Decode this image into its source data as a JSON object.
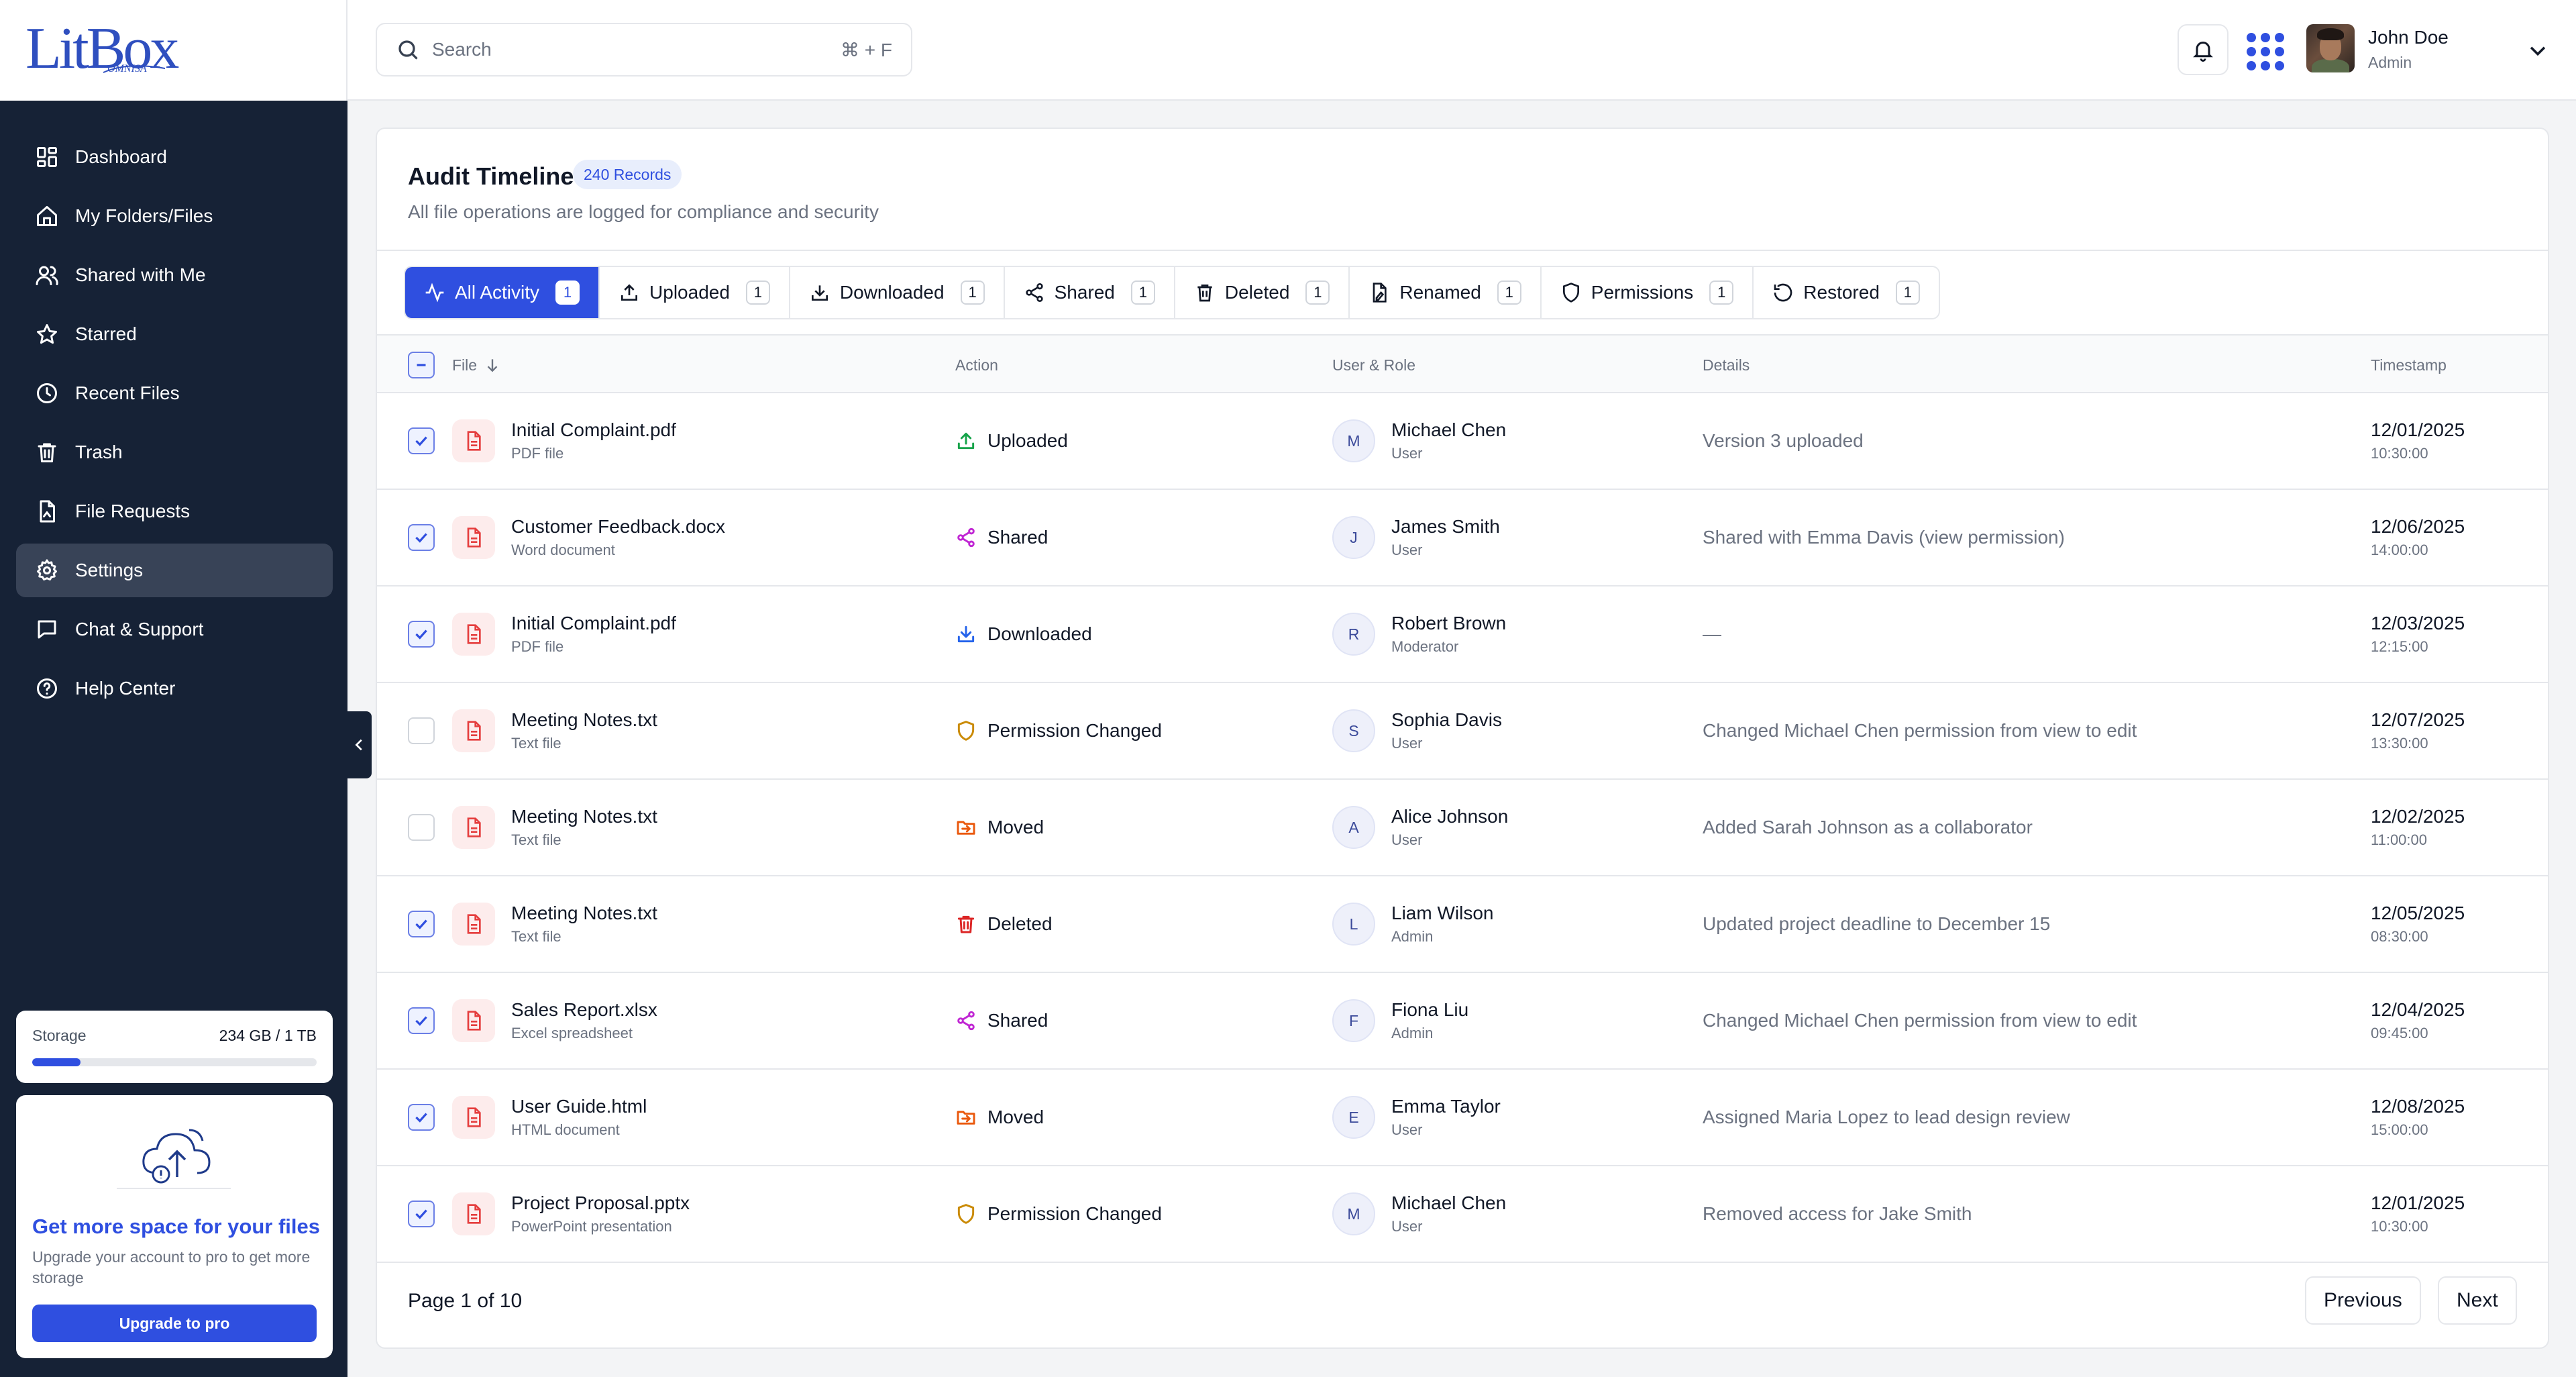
{
  "brand": {
    "logo": "LitBox",
    "sub": "OMNISA"
  },
  "colors": {
    "accent": "#2f4fe0",
    "sidebar": "#162236"
  },
  "sidebar": {
    "items": [
      {
        "label": "Dashboard",
        "icon": "dashboard-icon"
      },
      {
        "label": "My Folders/Files",
        "icon": "home-icon"
      },
      {
        "label": "Shared with Me",
        "icon": "users-icon"
      },
      {
        "label": "Starred",
        "icon": "star-icon"
      },
      {
        "label": "Recent Files",
        "icon": "clock-icon"
      },
      {
        "label": "Trash",
        "icon": "trash-icon"
      },
      {
        "label": "File Requests",
        "icon": "file-request-icon"
      },
      {
        "label": "Settings",
        "icon": "gear-icon",
        "active": true
      },
      {
        "label": "Chat & Support",
        "icon": "chat-icon"
      },
      {
        "label": "Help Center",
        "icon": "help-icon"
      }
    ],
    "storage": {
      "label": "Storage",
      "value": "234 GB / 1 TB",
      "fill_percent": 17
    },
    "upgrade": {
      "title": "Get more space for your files",
      "text": "Upgrade your account to pro to get more storage",
      "button": "Upgrade to pro"
    }
  },
  "header": {
    "search_placeholder": "Search",
    "shortcut": "⌘ + F",
    "user": {
      "name": "John Doe",
      "role": "Admin"
    }
  },
  "main": {
    "title": "Audit Timeline",
    "badge": "240 Records",
    "subtitle": "All file operations are logged for compliance and security",
    "filters": [
      {
        "label": "All Activity",
        "count": "1",
        "icon": "activity-icon",
        "active": true
      },
      {
        "label": "Uploaded",
        "count": "1",
        "icon": "upload-icon"
      },
      {
        "label": "Downloaded",
        "count": "1",
        "icon": "download-icon"
      },
      {
        "label": "Shared",
        "count": "1",
        "icon": "share-icon"
      },
      {
        "label": "Deleted",
        "count": "1",
        "icon": "trash-icon"
      },
      {
        "label": "Renamed",
        "count": "1",
        "icon": "rename-icon"
      },
      {
        "label": "Permissions",
        "count": "1",
        "icon": "shield-icon"
      },
      {
        "label": "Restored",
        "count": "1",
        "icon": "restore-icon"
      }
    ],
    "columns": {
      "file": "File",
      "action": "Action",
      "user": "User & Role",
      "details": "Details",
      "timestamp": "Timestamp"
    },
    "rows": [
      {
        "checked": true,
        "file": "Initial Complaint.pdf",
        "type": "PDF file",
        "action": "Uploaded",
        "action_icon": "upload-icon",
        "action_color": "#16a34a",
        "initial": "M",
        "user": "Michael Chen",
        "role": "User",
        "details": "Version 3 uploaded",
        "date": "12/01/2025",
        "time": "10:30:00"
      },
      {
        "checked": true,
        "file": "Customer Feedback.docx",
        "type": "Word document",
        "action": "Shared",
        "action_icon": "share-icon",
        "action_color": "#c026d3",
        "initial": "J",
        "user": "James Smith",
        "role": "User",
        "details": "Shared with Emma Davis (view permission)",
        "date": "12/06/2025",
        "time": "14:00:00"
      },
      {
        "checked": true,
        "file": "Initial Complaint.pdf",
        "type": "PDF file",
        "action": "Downloaded",
        "action_icon": "download-icon",
        "action_color": "#2563eb",
        "initial": "R",
        "user": "Robert Brown",
        "role": "Moderator",
        "details": "—",
        "date": "12/03/2025",
        "time": "12:15:00"
      },
      {
        "checked": false,
        "file": "Meeting Notes.txt",
        "type": "Text file",
        "action": "Permission Changed",
        "action_icon": "shield-icon",
        "action_color": "#ca8a04",
        "initial": "S",
        "user": "Sophia Davis",
        "role": "User",
        "details": "Changed Michael Chen permission from view to edit",
        "date": "12/07/2025",
        "time": "13:30:00"
      },
      {
        "checked": false,
        "file": "Meeting Notes.txt",
        "type": "Text file",
        "action": "Moved",
        "action_icon": "move-icon",
        "action_color": "#ea580c",
        "initial": "A",
        "user": "Alice Johnson",
        "role": "User",
        "details": "Added Sarah Johnson as a collaborator",
        "date": "12/02/2025",
        "time": "11:00:00"
      },
      {
        "checked": true,
        "file": "Meeting Notes.txt",
        "type": "Text file",
        "action": "Deleted",
        "action_icon": "trash-icon",
        "action_color": "#dc2626",
        "initial": "L",
        "user": "Liam Wilson",
        "role": "Admin",
        "details": "Updated project deadline to December 15",
        "date": "12/05/2025",
        "time": "08:30:00"
      },
      {
        "checked": true,
        "file": "Sales Report.xlsx",
        "type": "Excel spreadsheet",
        "action": "Shared",
        "action_icon": "share-icon",
        "action_color": "#c026d3",
        "initial": "F",
        "user": "Fiona Liu",
        "role": "Admin",
        "details": "Changed Michael Chen permission from view to edit",
        "date": "12/04/2025",
        "time": "09:45:00"
      },
      {
        "checked": true,
        "file": "User Guide.html",
        "type": "HTML document",
        "action": "Moved",
        "action_icon": "move-icon",
        "action_color": "#ea580c",
        "initial": "E",
        "user": "Emma Taylor",
        "role": "User",
        "details": "Assigned Maria Lopez to lead design review",
        "date": "12/08/2025",
        "time": "15:00:00"
      },
      {
        "checked": true,
        "file": "Project Proposal.pptx",
        "type": "PowerPoint presentation",
        "action": "Permission Changed",
        "action_icon": "shield-icon",
        "action_color": "#ca8a04",
        "initial": "M",
        "user": "Michael Chen",
        "role": "User",
        "details": "Removed access for Jake Smith",
        "date": "12/01/2025",
        "time": "10:30:00"
      }
    ],
    "pagination": {
      "info": "Page 1 of 10",
      "prev": "Previous",
      "next": "Next"
    }
  }
}
